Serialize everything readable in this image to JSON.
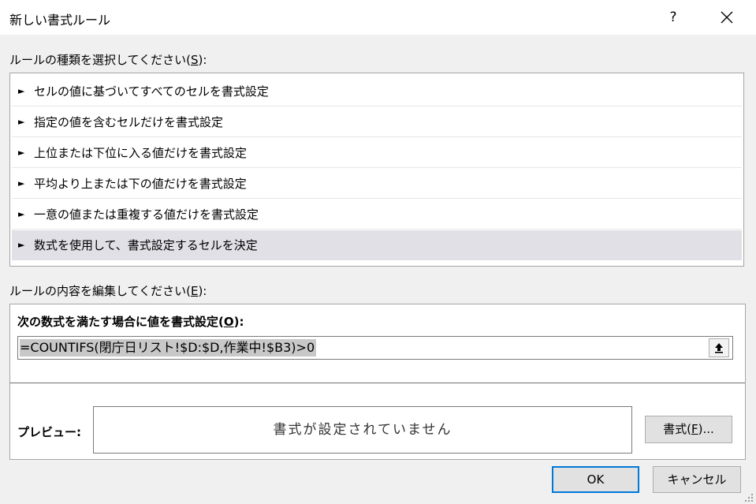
{
  "window": {
    "title": "新しい書式ルール",
    "help_glyph": "?"
  },
  "rule_type": {
    "label_prefix": "ルールの種類を選択してください(",
    "label_key": "S",
    "label_suffix": "):",
    "items": [
      {
        "label": "セルの値に基づいてすべてのセルを書式設定"
      },
      {
        "label": "指定の値を含むセルだけを書式設定"
      },
      {
        "label": "上位または下位に入る値だけを書式設定"
      },
      {
        "label": "平均より上または下の値だけを書式設定"
      },
      {
        "label": "一意の値または重複する値だけを書式設定"
      },
      {
        "label": "数式を使用して、書式設定するセルを決定",
        "selected": true
      }
    ],
    "arrow_glyph": "►"
  },
  "edit_rule": {
    "label_prefix": "ルールの内容を編集してください(",
    "label_key": "E",
    "label_suffix": "):",
    "formula_caption_prefix": "次の数式を満たす場合に値を書式設定(",
    "formula_caption_key": "O",
    "formula_caption_suffix": "):",
    "formula_value": "=COUNTIFS(閉庁日リスト!$D:$D,作業中!$B3)>0",
    "preview_label": "プレビュー:",
    "preview_text": "書式が設定されていません",
    "format_button_prefix": "書式(",
    "format_button_key": "F",
    "format_button_suffix": ")..."
  },
  "buttons": {
    "ok": "OK",
    "cancel": "キャンセル"
  },
  "colors": {
    "dialog_bg": "#f0f0f0",
    "selected_row": "#e0e0e6",
    "ok_border_accent": "#0078d7",
    "formula_highlight": "#c8c8c8"
  },
  "icons": {
    "close": "close-icon",
    "collapse": "collapse-dialog-icon",
    "list_arrow": "triangle-right-icon",
    "resize": "resize-grip-icon"
  }
}
